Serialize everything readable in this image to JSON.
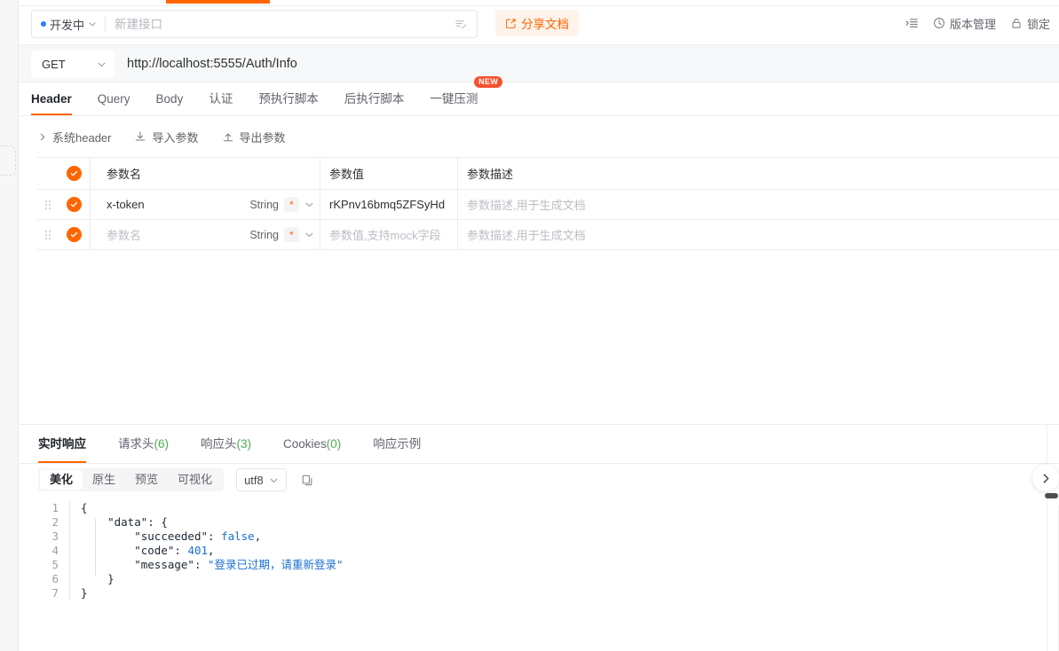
{
  "window": {
    "active_tab_marker": true
  },
  "header": {
    "status_label": "开发中",
    "name_placeholder": "新建接口",
    "name_value": "",
    "share_label": "分享文档",
    "actions": [
      {
        "name": "panel-toggle",
        "label": ""
      },
      {
        "name": "version-manage",
        "label": "版本管理"
      },
      {
        "name": "lock",
        "label": "锁定"
      }
    ]
  },
  "request": {
    "method": "GET",
    "url": "http://localhost:5555/Auth/Info",
    "tabs": [
      {
        "label": "Header",
        "active": true,
        "badge": ""
      },
      {
        "label": "Query",
        "active": false,
        "badge": ""
      },
      {
        "label": "Body",
        "active": false,
        "badge": ""
      },
      {
        "label": "认证",
        "active": false,
        "badge": ""
      },
      {
        "label": "预执行脚本",
        "active": false,
        "badge": ""
      },
      {
        "label": "后执行脚本",
        "active": false,
        "badge": ""
      },
      {
        "label": "一键压测",
        "active": false,
        "badge": "NEW"
      }
    ],
    "toolbar": [
      {
        "label": "系统header",
        "icon": "chevron-right-icon"
      },
      {
        "label": "导入参数",
        "icon": "import-icon"
      },
      {
        "label": "导出参数",
        "icon": "export-icon"
      }
    ],
    "table": {
      "columns": [
        "参数名",
        "参数值",
        "参数描述"
      ],
      "rows": [
        {
          "checked": true,
          "name": "x-token",
          "name_placeholder": "参数名",
          "type": "String",
          "required": "*",
          "value": "rKPnv16bmq5ZFSyHd",
          "value_placeholder": "参数值,支持mock字段",
          "desc": "",
          "desc_placeholder": "参数描述,用于生成文档"
        },
        {
          "checked": true,
          "name": "",
          "name_placeholder": "参数名",
          "type": "String",
          "required": "*",
          "value": "",
          "value_placeholder": "参数值,支持mock字段",
          "desc": "",
          "desc_placeholder": "参数描述,用于生成文档"
        }
      ]
    }
  },
  "response": {
    "tabs": [
      {
        "label": "实时响应",
        "count": "",
        "active": true
      },
      {
        "label": "请求头",
        "count": "(6)",
        "active": false
      },
      {
        "label": "响应头",
        "count": "(3)",
        "active": false
      },
      {
        "label": "Cookies",
        "count": "(0)",
        "active": false
      },
      {
        "label": "响应示例",
        "count": "",
        "active": false
      }
    ],
    "view_modes": [
      {
        "label": "美化",
        "active": true
      },
      {
        "label": "原生",
        "active": false
      },
      {
        "label": "预览",
        "active": false
      },
      {
        "label": "可视化",
        "active": false
      }
    ],
    "encoding": "utf8",
    "copy_icon": "copy-icon",
    "body_lines": [
      {
        "n": "1",
        "text": "{"
      },
      {
        "n": "2",
        "text": "    \"data\": {"
      },
      {
        "n": "3",
        "text": "        \"succeeded\": false,"
      },
      {
        "n": "4",
        "text": "        \"code\": 401,"
      },
      {
        "n": "5",
        "text": "        \"message\": \"登录已过期，请重新登录\""
      },
      {
        "n": "6",
        "text": "    }"
      },
      {
        "n": "7",
        "text": "}"
      }
    ],
    "parsed": {
      "data": {
        "succeeded": "false",
        "code": "401",
        "message": "登录已过期，请重新登录"
      }
    }
  },
  "colors": {
    "accent": "#ff6600",
    "accent_soft": "#fef3ea",
    "badge_new": "#f7502e",
    "count_green": "#4cae4c",
    "json_value_blue": "#1a6fd4",
    "status_dot_blue": "#2b7fff"
  }
}
